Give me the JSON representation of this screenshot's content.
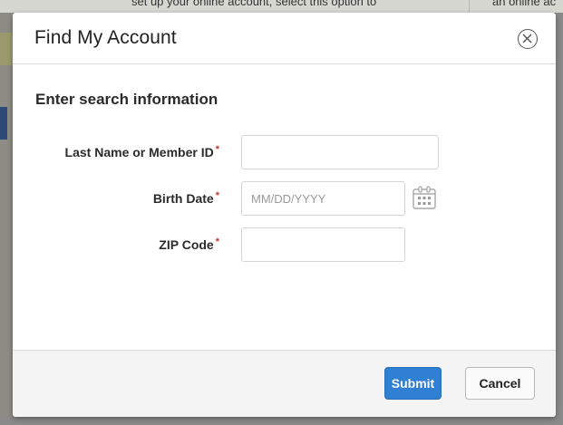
{
  "background": {
    "left_text": "set up your online account, select this option to",
    "right_text": "an online ac"
  },
  "modal": {
    "title": "Find My Account",
    "close_icon": "close-circle-icon"
  },
  "form": {
    "section_title": "Enter search information",
    "required_marker": "*",
    "fields": {
      "last_name": {
        "label": "Last Name or Member ID",
        "value": "",
        "placeholder": ""
      },
      "birth_date": {
        "label": "Birth Date",
        "value": "",
        "placeholder": "MM/DD/YYYY",
        "icon": "calendar-icon"
      },
      "zip_code": {
        "label": "ZIP Code",
        "value": "",
        "placeholder": ""
      }
    }
  },
  "footer": {
    "submit_label": "Submit",
    "cancel_label": "Cancel"
  },
  "colors": {
    "primary": "#2f7fd3",
    "required": "#c23934",
    "footer_bg": "#f4f4f4"
  }
}
